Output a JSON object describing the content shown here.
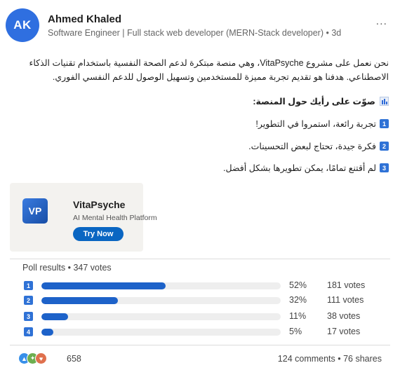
{
  "post": {
    "author_name": "Ahmed Khaled",
    "author_initials": "AK",
    "headline": "Software Engineer | Full stack web developer (MERN-Stack developer) • 3d",
    "more_label": "...",
    "body": "نحن نعمل على مشروع VitaPsyche، وهي منصة مبتكرة لدعم الصحة النفسية باستخدام تقنيات الذكاء الاصطناعي. هدفنا هو تقديم تجربة مميزة للمستخدمين وتسهيل الوصول للدعم النفسي الفوري.",
    "poll_intro": "صوّت على رأيك حول المنصة:",
    "poll_icon": "bar-chart-icon",
    "options": [
      {
        "num": "1",
        "text": "تجربة رائعة، استمروا في التطوير!"
      },
      {
        "num": "2",
        "text": "فكرة جيدة، تحتاج لبعض التحسينات."
      },
      {
        "num": "3",
        "text": "لم أقتنع تمامًا، يمكن تطويرها بشكل أفضل."
      }
    ]
  },
  "card": {
    "logo": "VP",
    "title": "VitaPsyche",
    "subtitle": "AI Mental Health Platform",
    "button": "Try Now"
  },
  "poll": {
    "header": "Poll results • 347 votes",
    "results": [
      {
        "num": "1",
        "percent": 52,
        "percent_label": "52%",
        "votes_label": "181 votes"
      },
      {
        "num": "2",
        "percent": 32,
        "percent_label": "32%",
        "votes_label": "111 votes"
      },
      {
        "num": "3",
        "percent": 11,
        "percent_label": "11%",
        "votes_label": "38 votes"
      },
      {
        "num": "4",
        "percent": 5,
        "percent_label": "5%",
        "votes_label": "17 votes"
      }
    ]
  },
  "footer": {
    "reaction_icons": [
      "like-icon",
      "celebrate-icon",
      "love-icon"
    ],
    "reaction_count": "658",
    "stats": "124 comments • 76 shares"
  },
  "colors": {
    "accent": "#0a66c2",
    "bar_fill": "#1d62c9",
    "avatar_bg": "#2f6fe0"
  }
}
